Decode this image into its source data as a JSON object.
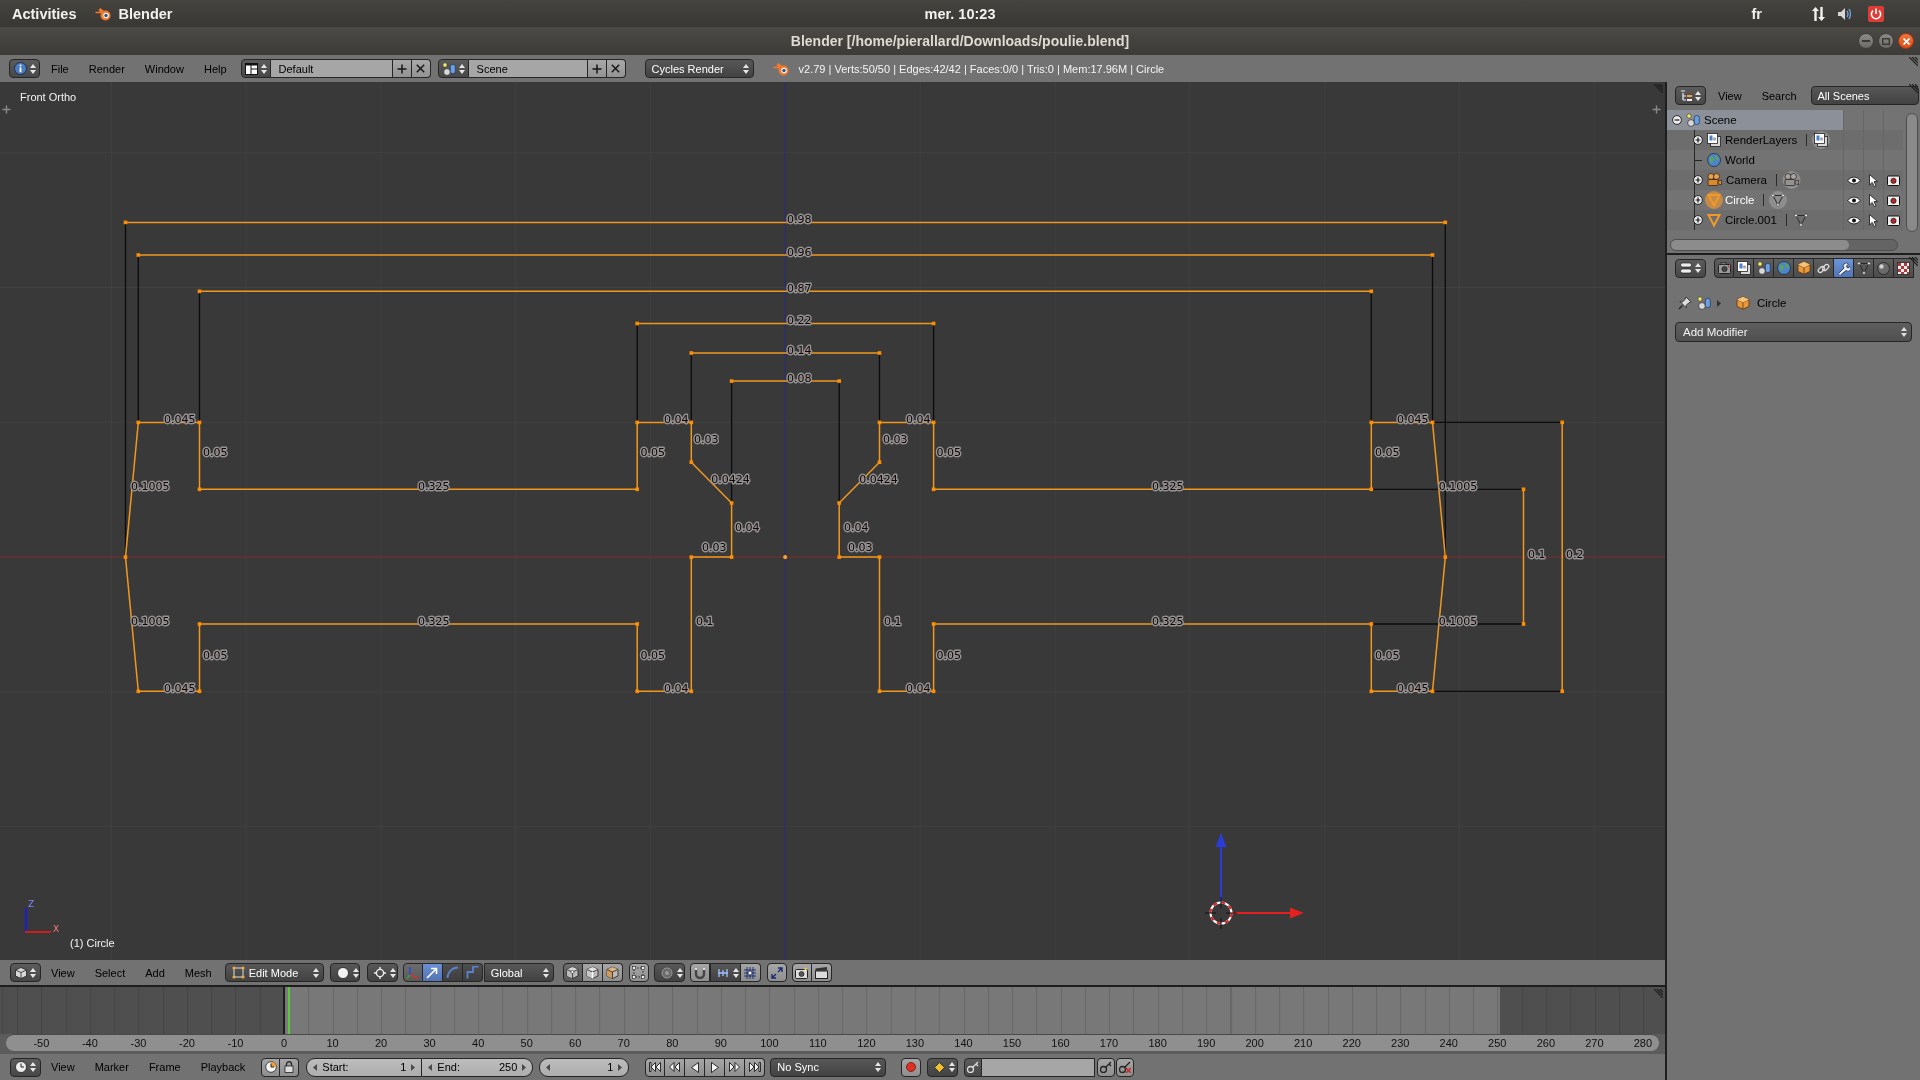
{
  "top_bar": {
    "activities": "Activities",
    "app_name": "Blender",
    "clock": "mer. 10:23",
    "keyboard_layout": "fr"
  },
  "window": {
    "title": "Blender [/home/pierallard/Downloads/poulie.blend]"
  },
  "info_header": {
    "menus": [
      "File",
      "Render",
      "Window",
      "Help"
    ],
    "screen_layout": "Default",
    "scene": "Scene",
    "render_engine": "Cycles Render",
    "stats": "v2.79 | Verts:50/50 | Edges:42/42 | Faces:0/0 | Tris:0 | Mem:17.96M | Circle"
  },
  "viewport": {
    "view_name": "Front Ortho",
    "object_label": "(1) Circle",
    "axis_labels": [
      "Z",
      "X"
    ],
    "edge_lengths": [
      "0.98",
      "0.96",
      "0.87",
      "0.22",
      "0.14",
      "0.08",
      "0.045",
      "0.04",
      "0.04",
      "0.045",
      "0.03",
      "0.03",
      "0.05",
      "0.05",
      "0.05",
      "0.05",
      "0.0424",
      "0.0424",
      "0.1005",
      "0.325",
      "0.325",
      "0.1005",
      "0.04",
      "0.04",
      "0.03",
      "0.03",
      "0.1",
      "0.2",
      "0.1005",
      "0.325",
      "0.1",
      "0.1",
      "0.325",
      "0.1005",
      "0.05",
      "0.05",
      "0.05",
      "0.05",
      "0.045",
      "0.04",
      "0.04",
      "0.045"
    ]
  },
  "view3d_header": {
    "menus": [
      "View",
      "Select",
      "Add",
      "Mesh"
    ],
    "mode": "Edit Mode",
    "orientation": "Global",
    "manipulators": [
      {
        "kind": "toggle",
        "selected": true
      },
      {
        "kind": "translate",
        "selected": true
      },
      {
        "kind": "rotate",
        "selected": false
      },
      {
        "kind": "scale",
        "selected": false
      }
    ],
    "select_modes": [
      {
        "kind": "vertex",
        "selected": true
      },
      {
        "kind": "edge",
        "selected": false
      },
      {
        "kind": "face",
        "selected": false
      }
    ]
  },
  "timeline": {
    "ruler": [
      "-50",
      "-40",
      "-30",
      "-20",
      "-10",
      "0",
      "10",
      "20",
      "30",
      "40",
      "50",
      "60",
      "70",
      "80",
      "90",
      "100",
      "110",
      "120",
      "130",
      "140",
      "150",
      "160",
      "170",
      "180",
      "190",
      "200",
      "210",
      "220",
      "230",
      "240",
      "250",
      "260",
      "270",
      "280"
    ]
  },
  "timeline_header": {
    "menus": [
      "View",
      "Marker",
      "Frame",
      "Playback"
    ],
    "start": {
      "label": "Start:",
      "value": "1"
    },
    "end": {
      "label": "End:",
      "value": "250"
    },
    "current_frame": "1",
    "sync": "No Sync"
  },
  "outliner": {
    "menus": [
      "View",
      "Search"
    ],
    "display_mode": "All Scenes",
    "tree": [
      {
        "name": "Scene",
        "kind": "scene",
        "expanded": true,
        "highlighted": true,
        "selected": false,
        "children": [
          {
            "name": "RenderLayers",
            "kind": "render_layers",
            "expanded": false,
            "highlighted": false,
            "selected": false,
            "data_active": true
          },
          {
            "name": "World",
            "kind": "world",
            "highlighted": false,
            "selected": false
          },
          {
            "name": "Camera",
            "kind": "camera",
            "expanded": false,
            "highlighted": false,
            "selected": false,
            "data_active": true,
            "visible": true,
            "selectable": true,
            "renderable": true
          },
          {
            "name": "Circle",
            "kind": "mesh",
            "expanded": false,
            "highlighted": false,
            "selected": true,
            "data_active": true,
            "visible": true,
            "selectable": true,
            "renderable": true
          },
          {
            "name": "Circle.001",
            "kind": "mesh",
            "expanded": false,
            "highlighted": false,
            "selected": false,
            "data_active": false,
            "visible": true,
            "selectable": true,
            "renderable": true
          }
        ]
      }
    ]
  },
  "properties": {
    "tabs": [
      {
        "kind": "render",
        "selected": false
      },
      {
        "kind": "render_layers",
        "selected": false
      },
      {
        "kind": "scene",
        "selected": false
      },
      {
        "kind": "world",
        "selected": false
      },
      {
        "kind": "object",
        "selected": false
      },
      {
        "kind": "constraints",
        "selected": false
      },
      {
        "kind": "modifiers",
        "selected": true
      },
      {
        "kind": "data",
        "selected": false
      },
      {
        "kind": "material",
        "selected": false
      },
      {
        "kind": "texture",
        "selected": false
      }
    ],
    "object_name": "Circle",
    "add_modifier": "Add Modifier"
  }
}
